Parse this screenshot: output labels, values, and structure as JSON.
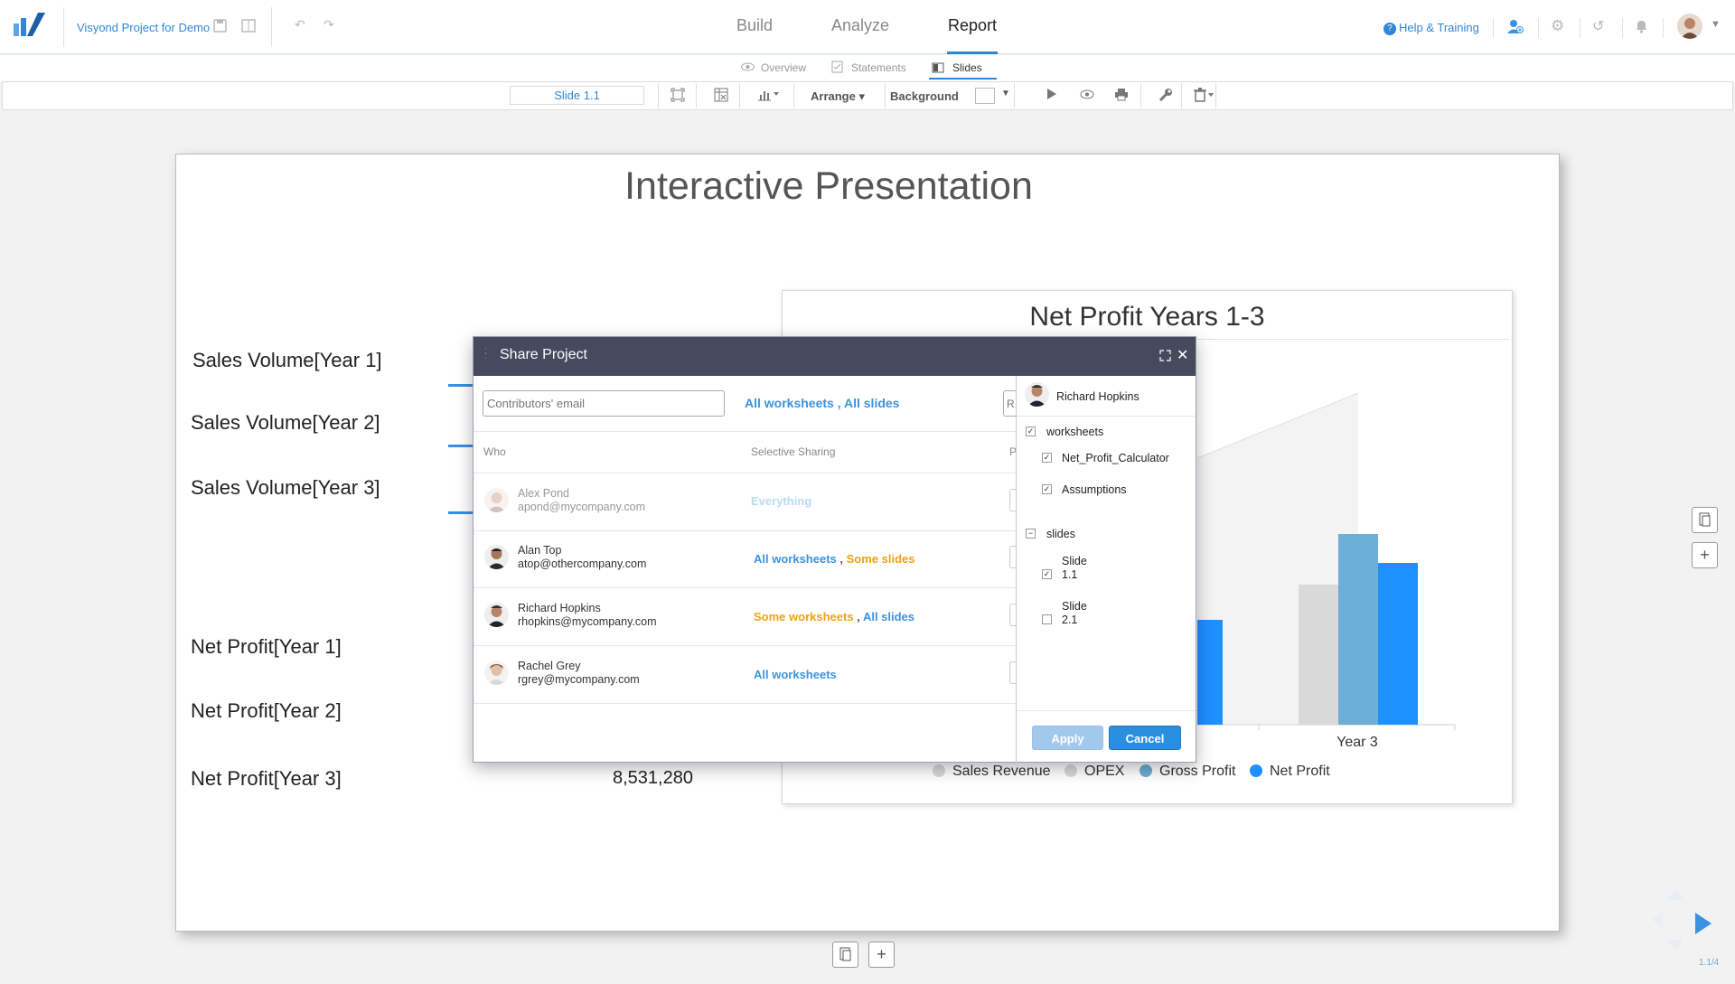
{
  "app": {
    "project_title": "Visyond Project for Demo",
    "help_label": "Help & Training"
  },
  "nav": {
    "tabs": [
      "Build",
      "Analyze",
      "Report"
    ],
    "active": "Report"
  },
  "subnav": {
    "tabs": [
      "Overview",
      "Statements",
      "Slides"
    ],
    "active": "Slides"
  },
  "toolbar": {
    "slide_name": "Slide 1.1",
    "arrange_label": "Arrange ▾",
    "background_label": "Background"
  },
  "slide": {
    "title": "Interactive Presentation",
    "rows": [
      {
        "label": "Sales Volume[Year 1]"
      },
      {
        "label": "Sales Volume[Year 2]"
      },
      {
        "label": "Sales Volume[Year 3]"
      },
      {
        "label": "Net Profit[Year 1]"
      },
      {
        "label": "Net Profit[Year 2]"
      },
      {
        "label": "Net Profit[Year 3]",
        "value": "8,531,280"
      }
    ],
    "page_indicator": "1.1/4"
  },
  "chart_data": {
    "type": "bar",
    "title": "Net Profit Years 1-3",
    "categories": [
      "Year 3"
    ],
    "series": [
      {
        "name": "Sales Revenue",
        "color": "#d9d9d9"
      },
      {
        "name": "OPEX",
        "color": "#d9d9d9"
      },
      {
        "name": "Gross Profit",
        "color": "#6baed6"
      },
      {
        "name": "Net Profit",
        "color": "#1e90ff"
      }
    ],
    "legend": "bottom"
  },
  "modal": {
    "title": "Share Project",
    "email_placeholder": "Contributors' email",
    "default_scope": {
      "ws": "All worksheets",
      "sep": ",",
      "slides": "All slides"
    },
    "columns": {
      "who": "Who",
      "selective": "Selective Sharing"
    },
    "users": [
      {
        "name": "Alex Pond",
        "email": "apond@mycompany.com",
        "sharing": [
          {
            "text": "Everything",
            "style": "grey"
          }
        ]
      },
      {
        "name": "Alan Top",
        "email": "atop@othercompany.com",
        "sharing": [
          {
            "text": "All worksheets",
            "style": "blue"
          },
          {
            "text": ",",
            "style": "sep"
          },
          {
            "text": "Some slides",
            "style": "orange"
          }
        ]
      },
      {
        "name": "Richard Hopkins",
        "email": "rhopkins@mycompany.com",
        "sharing": [
          {
            "text": "Some worksheets",
            "style": "orange"
          },
          {
            "text": ",",
            "style": "sep"
          },
          {
            "text": "All slides",
            "style": "blue"
          }
        ]
      },
      {
        "name": "Rachel Grey",
        "email": "rgrey@mycompany.com",
        "sharing": [
          {
            "text": "All worksheets",
            "style": "blue"
          }
        ]
      }
    ],
    "panel": {
      "user": "Richard Hopkins",
      "worksheets_label": "worksheets",
      "worksheets": [
        {
          "name": "Net_Profit_Calculator",
          "checked": true
        },
        {
          "name": "Assumptions",
          "checked": true
        }
      ],
      "slides_label": "slides",
      "slides": [
        {
          "line1": "Slide",
          "line2": "1.1",
          "checked": true
        },
        {
          "line1": "Slide",
          "line2": "2.1",
          "checked": false
        }
      ],
      "apply_label": "Apply",
      "cancel_label": "Cancel"
    }
  }
}
